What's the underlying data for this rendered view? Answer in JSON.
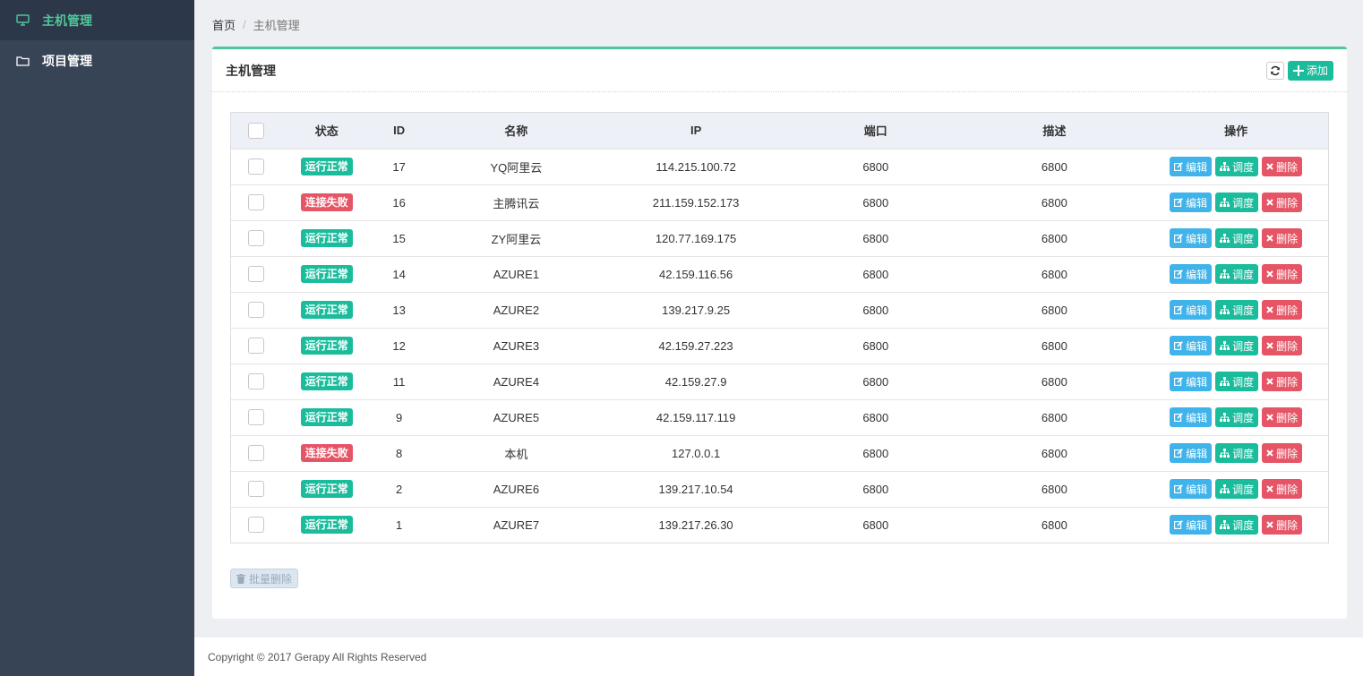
{
  "sidebar": {
    "items": [
      {
        "label": "主机管理",
        "icon": "monitor-icon",
        "active": true
      },
      {
        "label": "项目管理",
        "icon": "folder-icon",
        "active": false
      }
    ]
  },
  "breadcrumb": {
    "home": "首页",
    "separator": "/",
    "current": "主机管理"
  },
  "card": {
    "title": "主机管理",
    "add_label": "添加",
    "accent_color": "#4fc79a"
  },
  "table": {
    "headers": {
      "status": "状态",
      "id": "ID",
      "name": "名称",
      "ip": "IP",
      "port": "端口",
      "desc": "描述",
      "ops": "操作"
    },
    "rows": [
      {
        "status": "运行正常",
        "ok": true,
        "id": "17",
        "name": "YQ阿里云",
        "ip": "114.215.100.72",
        "port": "6800",
        "desc": "6800"
      },
      {
        "status": "连接失败",
        "ok": false,
        "id": "16",
        "name": "主腾讯云",
        "ip": "211.159.152.173",
        "port": "6800",
        "desc": "6800"
      },
      {
        "status": "运行正常",
        "ok": true,
        "id": "15",
        "name": "ZY阿里云",
        "ip": "120.77.169.175",
        "port": "6800",
        "desc": "6800"
      },
      {
        "status": "运行正常",
        "ok": true,
        "id": "14",
        "name": "AZURE1",
        "ip": "42.159.116.56",
        "port": "6800",
        "desc": "6800"
      },
      {
        "status": "运行正常",
        "ok": true,
        "id": "13",
        "name": "AZURE2",
        "ip": "139.217.9.25",
        "port": "6800",
        "desc": "6800"
      },
      {
        "status": "运行正常",
        "ok": true,
        "id": "12",
        "name": "AZURE3",
        "ip": "42.159.27.223",
        "port": "6800",
        "desc": "6800"
      },
      {
        "status": "运行正常",
        "ok": true,
        "id": "11",
        "name": "AZURE4",
        "ip": "42.159.27.9",
        "port": "6800",
        "desc": "6800"
      },
      {
        "status": "运行正常",
        "ok": true,
        "id": "9",
        "name": "AZURE5",
        "ip": "42.159.117.119",
        "port": "6800",
        "desc": "6800"
      },
      {
        "status": "连接失败",
        "ok": false,
        "id": "8",
        "name": "本机",
        "ip": "127.0.0.1",
        "port": "6800",
        "desc": "6800"
      },
      {
        "status": "运行正常",
        "ok": true,
        "id": "2",
        "name": "AZURE6",
        "ip": "139.217.10.54",
        "port": "6800",
        "desc": "6800"
      },
      {
        "status": "运行正常",
        "ok": true,
        "id": "1",
        "name": "AZURE7",
        "ip": "139.217.26.30",
        "port": "6800",
        "desc": "6800"
      }
    ],
    "ops": {
      "edit": "编辑",
      "dispatch": "调度",
      "delete": "删除"
    }
  },
  "batch_delete_label": "批量删除",
  "footer": {
    "copyright": "Copyright © 2017 Gerapy All Rights Reserved"
  },
  "colors": {
    "sidebar_bg": "#374456",
    "ok": "#1abc9c",
    "fail": "#e55565",
    "edit": "#3fb3ea"
  }
}
